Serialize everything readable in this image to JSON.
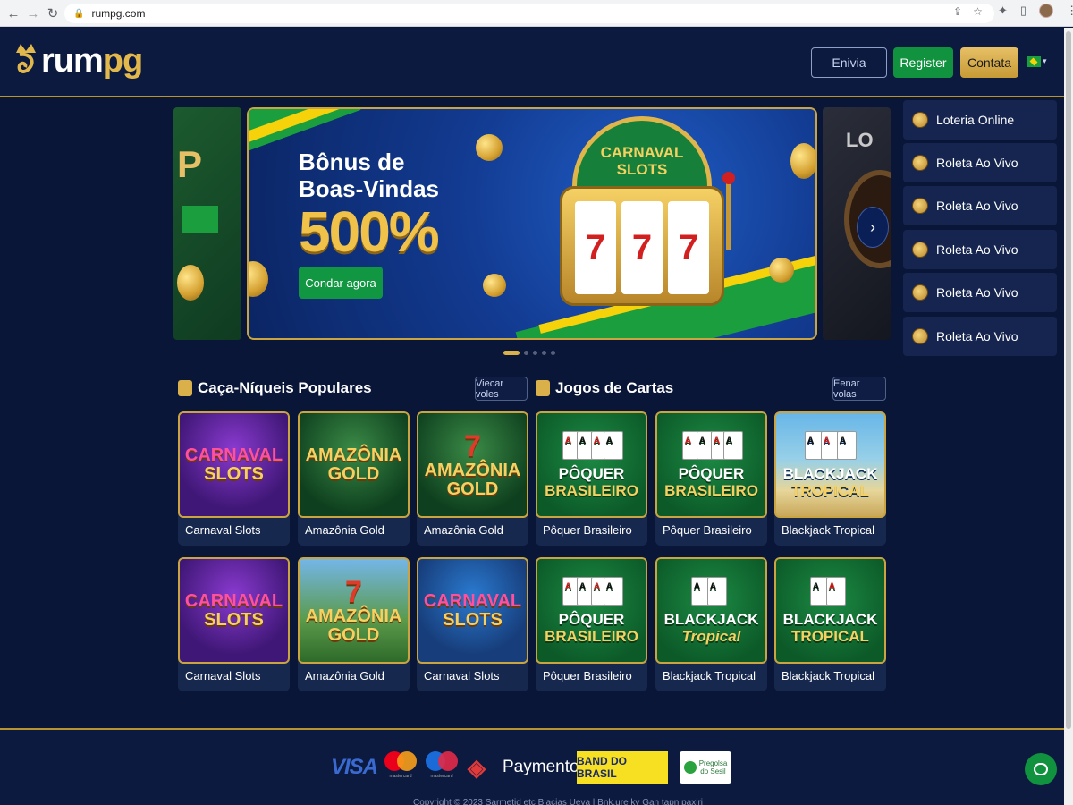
{
  "browser": {
    "url": "rumpg.com",
    "nav_icons": [
      "back-icon",
      "forward-icon",
      "reload-icon"
    ]
  },
  "header": {
    "logo_text_main": "rum",
    "logo_text_accent": "pg",
    "enviar_label": "Enivia",
    "register_label": "Register",
    "contata_label": "Contata",
    "language_flag": "flag-brazil-icon",
    "colors": {
      "gold": "#e2b84c",
      "green": "#11923e",
      "navy": "#0c1a40"
    }
  },
  "hero": {
    "title_line1": "Bônus de",
    "title_line2": "Boas-Vindas",
    "percent": "500%",
    "cta_label": "Condar agora",
    "slot_title_line1": "CARNAVAL",
    "slot_title_line2": "SLOTS",
    "reel1": "7",
    "reel2": "7",
    "reel3": "7",
    "left_preview_text": "P",
    "right_preview_text": "LO",
    "slide_count": 5,
    "active_slide": 1
  },
  "side_menu": [
    {
      "label": "Loteria Online",
      "icon": "coins-icon"
    },
    {
      "label": "Roleta Ao Vivo",
      "icon": "roulette-icon"
    },
    {
      "label": "Roleta Ao Vivo",
      "icon": "roulette-icon"
    },
    {
      "label": "Roleta Ao Vivo",
      "icon": "dealer-icon"
    },
    {
      "label": "Roleta Ao Vivo",
      "icon": "chips-icon"
    },
    {
      "label": "Roleta Ao Vivo",
      "icon": "wheel-icon"
    }
  ],
  "sections": {
    "slots": {
      "title": "Caça-Níqueis Populares",
      "button": "Viecar voles"
    },
    "cards": {
      "title": "Jogos de Cartas",
      "button": "Eenar volas"
    }
  },
  "games_row1": [
    {
      "label": "Carnaval Slots",
      "art1": "CARNAVAL",
      "art2": "SLOTS"
    },
    {
      "label": "Amazônia Gold",
      "art1": "AMAZÔNIA",
      "art2": "GOLD"
    },
    {
      "label": "Amazônia Gold",
      "art1": "AMAZÔNIA",
      "art2": "GOLD"
    },
    {
      "label": "Pôquer Brasileiro",
      "art1": "PÔQUER",
      "art2": "BRASILEIRO"
    },
    {
      "label": "Pôquer Brasileiro",
      "art1": "PÔQUER",
      "art2": "BRASILEIRO"
    },
    {
      "label": "Blackjack Tropical",
      "art1": "BLACKJACK",
      "art2": "TROPICAL"
    }
  ],
  "games_row2": [
    {
      "label": "Carnaval Slots",
      "art1": "CARNAVAL",
      "art2": "SLOTS"
    },
    {
      "label": "Amazônia Gold",
      "art1": "AMAZÔNIA",
      "art2": "GOLD"
    },
    {
      "label": "Carnaval Slots",
      "art1": "CARNAVAL",
      "art2": "SLOTS"
    },
    {
      "label": "Pôquer Brasileiro",
      "art1": "PÔQUER",
      "art2": "BRASILEIRO"
    },
    {
      "label": "Blackjack Tropical",
      "art1": "BLACKJACK",
      "art2": "Tropical"
    },
    {
      "label": "Blackjack Tropical",
      "art1": "BLACKJACK",
      "art2": "TROPICAL"
    }
  ],
  "footer": {
    "visa": "VISA",
    "mastercard_caption": "mastercard",
    "paymento": "Paymento",
    "banco": "BAND DO BRASIL",
    "pregolsa_line1": "Pregolsa",
    "pregolsa_line2": "do Sesil",
    "copyright": "Copyright © 2023 Sarmetid etc Biacias Ueva | Bnk.ure ky Gan tapn paxiri"
  }
}
